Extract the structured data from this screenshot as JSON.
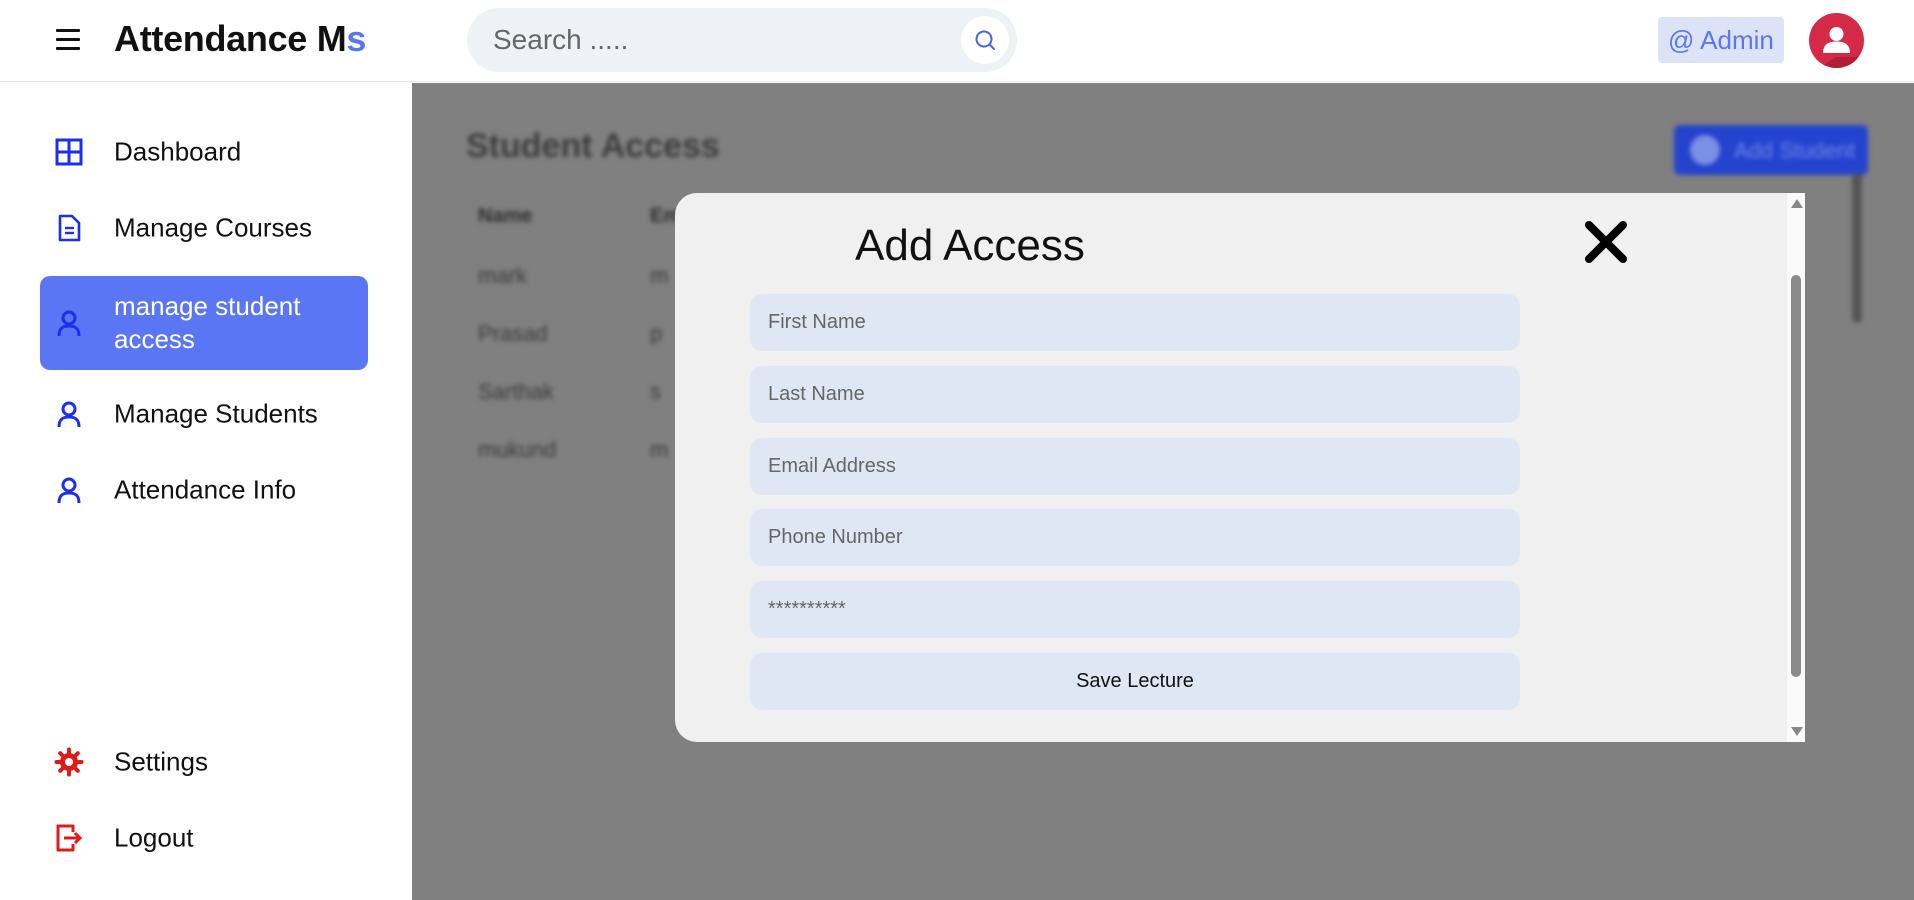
{
  "header": {
    "brand_main": "Attendance M",
    "brand_accent": "s",
    "search_placeholder": "Search .....",
    "admin_label": "@ Admin"
  },
  "sidebar": {
    "items": [
      {
        "label": "Dashboard",
        "icon": "grid-icon",
        "color": "#1a2ff0"
      },
      {
        "label": "Manage Courses",
        "icon": "document-icon",
        "color": "#1a2ff0"
      },
      {
        "label": "manage student access",
        "icon": "user-icon",
        "color": "#1a2ff0",
        "active": true
      },
      {
        "label": "Manage Students",
        "icon": "user-icon",
        "color": "#1a2ff0"
      },
      {
        "label": "Attendance Info",
        "icon": "user-icon",
        "color": "#1a2ff0"
      }
    ],
    "bottom_items": [
      {
        "label": "Settings",
        "icon": "gear-icon",
        "color": "#e01a1a"
      },
      {
        "label": "Logout",
        "icon": "logout-icon",
        "color": "#e01a1a"
      }
    ]
  },
  "background_page": {
    "title": "Student Access",
    "add_button_label": "Add Student",
    "columns": [
      "Name",
      "Em"
    ],
    "rows": [
      {
        "name": "mark",
        "email": "m"
      },
      {
        "name": "Prasad",
        "email": "p"
      },
      {
        "name": "Sarthak",
        "email": "s"
      },
      {
        "name": "mukund",
        "email": "m"
      }
    ]
  },
  "modal": {
    "title": "Add Access",
    "fields": {
      "first_name": "First Name",
      "last_name": "Last Name",
      "email": "Email Address",
      "phone": "Phone Number",
      "password": "**********"
    },
    "save_label": "Save Lecture"
  },
  "colors": {
    "accent": "#5a76f5",
    "avatar": "#d42a47",
    "overlay": "#808080"
  }
}
